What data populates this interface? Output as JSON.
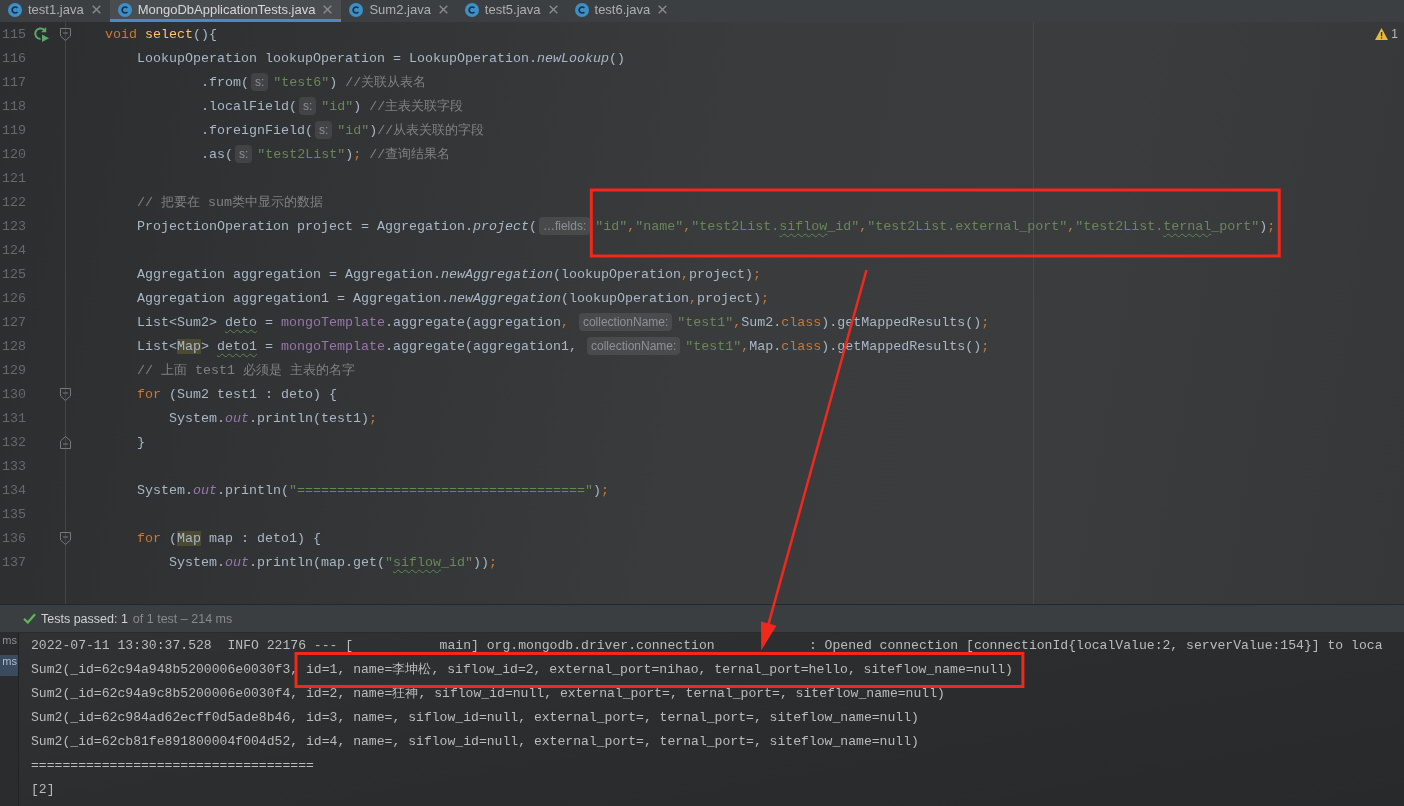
{
  "tabs": [
    {
      "label": "test1.java",
      "selected": false
    },
    {
      "label": "MongoDbApplicationTests.java",
      "selected": true
    },
    {
      "label": "Sum2.java",
      "selected": false
    },
    {
      "label": "test5.java",
      "selected": false
    },
    {
      "label": "test6.java",
      "selected": false
    }
  ],
  "inspection": {
    "warnings": "1"
  },
  "editor": {
    "lines": [
      {
        "number": "115",
        "gutter": [
          {
            "kind": "run"
          },
          {
            "kind": "foldstart"
          }
        ],
        "tokens": [
          {
            "text": "    void ",
            "kind": "keyword"
          },
          {
            "text": "select",
            "kind": "decl"
          },
          {
            "text": "(){",
            "kind": "plain"
          }
        ]
      },
      {
        "number": "116",
        "tokens": [
          {
            "text": "        LookupOperation lookupOperation = LookupOperation.",
            "kind": "plain"
          },
          {
            "text": "newLookup",
            "kind": "call"
          },
          {
            "text": "()",
            "kind": "plain"
          }
        ]
      },
      {
        "number": "117",
        "tokens": [
          {
            "text": "                .from(",
            "kind": "plain"
          },
          {
            "text": "s:",
            "kind": "hint"
          },
          {
            "text": "\"test6\"",
            "kind": "string"
          },
          {
            "text": ") ",
            "kind": "plain"
          },
          {
            "text": "//关联从表名",
            "kind": "comment"
          }
        ]
      },
      {
        "number": "118",
        "tokens": [
          {
            "text": "                .localField(",
            "kind": "plain"
          },
          {
            "text": "s:",
            "kind": "hint"
          },
          {
            "text": "\"id\"",
            "kind": "string"
          },
          {
            "text": ") ",
            "kind": "plain"
          },
          {
            "text": "//主表关联字段",
            "kind": "comment"
          }
        ]
      },
      {
        "number": "119",
        "tokens": [
          {
            "text": "                .foreignField(",
            "kind": "plain"
          },
          {
            "text": "s:",
            "kind": "hint"
          },
          {
            "text": "\"id\"",
            "kind": "string"
          },
          {
            "text": ")",
            "kind": "plain"
          },
          {
            "text": "//从表关联的字段",
            "kind": "comment"
          }
        ]
      },
      {
        "number": "120",
        "tokens": [
          {
            "text": "                .as(",
            "kind": "plain"
          },
          {
            "text": "s:",
            "kind": "hint"
          },
          {
            "text": "\"test2List\"",
            "kind": "string"
          },
          {
            "text": ")",
            "kind": "plain"
          },
          {
            "text": ";",
            "kind": "punct"
          },
          {
            "text": " //查询结果名",
            "kind": "comment"
          }
        ]
      },
      {
        "number": "121"
      },
      {
        "number": "122",
        "tokens": [
          {
            "text": "        // 把要在 sum类中显示的数据",
            "kind": "comment"
          }
        ]
      },
      {
        "number": "123",
        "tokens": [
          {
            "text": "        ProjectionOperation project = Aggregation.",
            "kind": "plain"
          },
          {
            "text": "project",
            "kind": "call"
          },
          {
            "text": "(",
            "kind": "plain"
          },
          {
            "text": "…fields:",
            "kind": "hint"
          },
          {
            "text": "\"id\"",
            "kind": "string"
          },
          {
            "text": ",",
            "kind": "punct"
          },
          {
            "text": "\"name\"",
            "kind": "string"
          },
          {
            "text": ",",
            "kind": "punct"
          },
          {
            "text": "\"test2List.",
            "kind": "string"
          },
          {
            "text": "siflow",
            "kind": "typostring"
          },
          {
            "text": "_id\"",
            "kind": "string"
          },
          {
            "text": ",",
            "kind": "punct"
          },
          {
            "text": "\"test2List.external_port\"",
            "kind": "string"
          },
          {
            "text": ",",
            "kind": "punct"
          },
          {
            "text": "\"test2List.",
            "kind": "string"
          },
          {
            "text": "ternal",
            "kind": "typostring"
          },
          {
            "text": "_port\"",
            "kind": "string"
          },
          {
            "text": ")",
            "kind": "plain"
          },
          {
            "text": ";",
            "kind": "punct"
          }
        ]
      },
      {
        "number": "124"
      },
      {
        "number": "125",
        "tokens": [
          {
            "text": "        Aggregation aggregation = Aggregation.",
            "kind": "plain"
          },
          {
            "text": "newAggregation",
            "kind": "call"
          },
          {
            "text": "(lookupOperation",
            "kind": "plain"
          },
          {
            "text": ",",
            "kind": "punct"
          },
          {
            "text": "project)",
            "kind": "plain"
          },
          {
            "text": ";",
            "kind": "punct"
          }
        ]
      },
      {
        "number": "126",
        "tokens": [
          {
            "text": "        Aggregation aggregation1 = Aggregation.",
            "kind": "plain"
          },
          {
            "text": "newAggregation",
            "kind": "call"
          },
          {
            "text": "(lookupOperation",
            "kind": "plain"
          },
          {
            "text": ",",
            "kind": "punct"
          },
          {
            "text": "project)",
            "kind": "plain"
          },
          {
            "text": ";",
            "kind": "punct"
          }
        ]
      },
      {
        "number": "127",
        "tokens": [
          {
            "text": "        List<Sum2> ",
            "kind": "plain"
          },
          {
            "text": "deto",
            "kind": "typo"
          },
          {
            "text": " = ",
            "kind": "plain"
          },
          {
            "text": "mongoTemplate",
            "kind": "field"
          },
          {
            "text": ".aggregate(aggregation",
            "kind": "plain"
          },
          {
            "text": ", ",
            "kind": "punct"
          },
          {
            "text": "collectionName:",
            "kind": "hint"
          },
          {
            "text": "\"test1\"",
            "kind": "string"
          },
          {
            "text": ",",
            "kind": "punct"
          },
          {
            "text": "Sum2.",
            "kind": "plain"
          },
          {
            "text": "class",
            "kind": "keyword"
          },
          {
            "text": ").getMappedResults()",
            "kind": "plain"
          },
          {
            "text": ";",
            "kind": "punct"
          }
        ]
      },
      {
        "number": "128",
        "tokens": [
          {
            "text": "        List<",
            "kind": "plain"
          },
          {
            "text": "Map",
            "kind": "usage"
          },
          {
            "text": "> ",
            "kind": "plain"
          },
          {
            "text": "deto1",
            "kind": "typo"
          },
          {
            "text": " = ",
            "kind": "plain"
          },
          {
            "text": "mongoTemplate",
            "kind": "field"
          },
          {
            "text": ".aggregate(aggregation1, ",
            "kind": "plain"
          },
          {
            "text": "collectionName:",
            "kind": "hint"
          },
          {
            "text": "\"test1\"",
            "kind": "string"
          },
          {
            "text": ",",
            "kind": "punct"
          },
          {
            "text": "Map.",
            "kind": "plain"
          },
          {
            "text": "class",
            "kind": "keyword"
          },
          {
            "text": ").getMappedResults()",
            "kind": "plain"
          },
          {
            "text": ";",
            "kind": "punct"
          }
        ]
      },
      {
        "number": "129",
        "tokens": [
          {
            "text": "        // 上面 test1 必须是 主表的名字",
            "kind": "comment"
          }
        ]
      },
      {
        "number": "130",
        "gutter": [
          {
            "kind": "foldstart"
          }
        ],
        "tokens": [
          {
            "text": "        for",
            "kind": "keyword"
          },
          {
            "text": " (Sum2 test1 : deto) {",
            "kind": "plain"
          }
        ]
      },
      {
        "number": "131",
        "tokens": [
          {
            "text": "            System.",
            "kind": "plain"
          },
          {
            "text": "out",
            "kind": "static"
          },
          {
            "text": ".println(test1)",
            "kind": "plain"
          },
          {
            "text": ";",
            "kind": "punct"
          }
        ]
      },
      {
        "number": "132",
        "gutter": [
          {
            "kind": "foldend"
          }
        ],
        "tokens": [
          {
            "text": "        }",
            "kind": "plain"
          }
        ]
      },
      {
        "number": "133"
      },
      {
        "number": "134",
        "tokens": [
          {
            "text": "        System.",
            "kind": "plain"
          },
          {
            "text": "out",
            "kind": "static"
          },
          {
            "text": ".println(",
            "kind": "plain"
          },
          {
            "text": "\"====================================\"",
            "kind": "string"
          },
          {
            "text": ")",
            "kind": "plain"
          },
          {
            "text": ";",
            "kind": "punct"
          }
        ]
      },
      {
        "number": "135"
      },
      {
        "number": "136",
        "gutter": [
          {
            "kind": "foldstart"
          }
        ],
        "tokens": [
          {
            "text": "        for",
            "kind": "keyword"
          },
          {
            "text": " (",
            "kind": "plain"
          },
          {
            "text": "Map",
            "kind": "usage"
          },
          {
            "text": " map : deto1) {",
            "kind": "plain"
          }
        ]
      },
      {
        "number": "137",
        "tokens": [
          {
            "text": "            System.",
            "kind": "plain"
          },
          {
            "text": "out",
            "kind": "static"
          },
          {
            "text": ".println(map.get(",
            "kind": "plain"
          },
          {
            "text": "\"",
            "kind": "string"
          },
          {
            "text": "siflow",
            "kind": "typostring"
          },
          {
            "text": "_id\"",
            "kind": "string"
          },
          {
            "text": "))",
            "kind": "plain"
          },
          {
            "text": ";",
            "kind": "punct"
          }
        ]
      }
    ]
  },
  "test_run": {
    "summary": "Tests passed: 1",
    "detail": "of 1 test – 214 ms"
  },
  "test_tree": [
    {
      "label": "ms",
      "selected": false
    },
    {
      "label": "ms",
      "selected": true
    }
  ],
  "console": [
    "2022-07-11 13:30:37.528  INFO 22176 --- [           main] org.mongodb.driver.connection            : Opened connection [connectionId{localValue:2, serverValue:154}] to loca",
    "Sum2(_id=62c94a948b5200006e0030f3, id=1, name=李坤松, siflow_id=2, external_port=nihao, ternal_port=hello, siteflow_name=null)",
    "Sum2(_id=62c94a9c8b5200006e0030f4, id=2, name=狂神, siflow_id=null, external_port=, ternal_port=, siteflow_name=null)",
    "Sum2(_id=62c984ad62ecff0d5ade8b46, id=3, name=, siflow_id=null, external_port=, ternal_port=, siteflow_name=null)",
    "Sum2(_id=62cb81fe891800004f004d52, id=4, name=, siflow_id=null, external_port=, ternal_port=, siteflow_name=null)",
    "====================================",
    "[2]"
  ]
}
